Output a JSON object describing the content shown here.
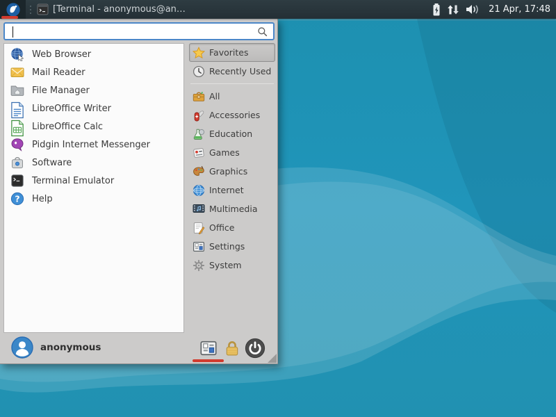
{
  "colors": {
    "desktop_base": "#1f95b5",
    "desktop_wave_light": "#ffffff",
    "desktop_shade_dark": "#0a3246",
    "panel_bg": "#28353b",
    "menu_bg": "#cccbca",
    "list_bg": "#fbfbfb",
    "accent_blue": "#4c87c8",
    "annotation_red": "#d23b2e",
    "text_dark": "#3a3a3a"
  },
  "panel": {
    "whisker_button": {
      "icon": "whisker-menu-icon"
    },
    "task_button": {
      "icon": "terminal-window-icon",
      "title": "[Terminal - anonymous@an…"
    },
    "tray": [
      {
        "icon": "battery-icon"
      },
      {
        "icon": "network-arrows-icon"
      },
      {
        "icon": "volume-icon"
      }
    ],
    "clock": "21 Apr, 17:48"
  },
  "menu": {
    "search": {
      "value": "",
      "placeholder": "",
      "icon": "search-icon"
    },
    "applications": [
      {
        "label": "Web Browser",
        "icon": "web-browser-icon"
      },
      {
        "label": "Mail Reader",
        "icon": "mail-reader-icon"
      },
      {
        "label": "File Manager",
        "icon": "file-manager-icon"
      },
      {
        "label": "LibreOffice Writer",
        "icon": "writer-icon"
      },
      {
        "label": "LibreOffice Calc",
        "icon": "calc-icon"
      },
      {
        "label": "Pidgin Internet Messenger",
        "icon": "pidgin-icon"
      },
      {
        "label": "Software",
        "icon": "software-icon"
      },
      {
        "label": "Terminal Emulator",
        "icon": "terminal-app-icon"
      },
      {
        "label": "Help",
        "icon": "help-icon"
      }
    ],
    "categories": [
      {
        "label": "Favorites",
        "icon": "star-icon",
        "selected": true
      },
      {
        "label": "Recently Used",
        "icon": "history-clock-icon",
        "separator_after": true
      },
      {
        "label": "All",
        "icon": "toolbox-icon"
      },
      {
        "label": "Accessories",
        "icon": "swiss-knife-icon"
      },
      {
        "label": "Education",
        "icon": "flask-icon"
      },
      {
        "label": "Games",
        "icon": "games-icon"
      },
      {
        "label": "Graphics",
        "icon": "palette-icon"
      },
      {
        "label": "Internet",
        "icon": "globe-icon"
      },
      {
        "label": "Multimedia",
        "icon": "multimedia-icon"
      },
      {
        "label": "Office",
        "icon": "office-icon"
      },
      {
        "label": "Settings",
        "icon": "settings-toggles-icon"
      },
      {
        "label": "System",
        "icon": "gear-icon"
      }
    ],
    "user": {
      "name": "anonymous",
      "icon": "avatar-icon"
    },
    "footer_buttons": [
      {
        "name": "all-settings-button",
        "icon": "settings-toggles-icon",
        "underlined": true
      },
      {
        "name": "lock-screen-button",
        "icon": "lock-icon"
      },
      {
        "name": "log-out-button",
        "icon": "power-icon"
      }
    ]
  }
}
